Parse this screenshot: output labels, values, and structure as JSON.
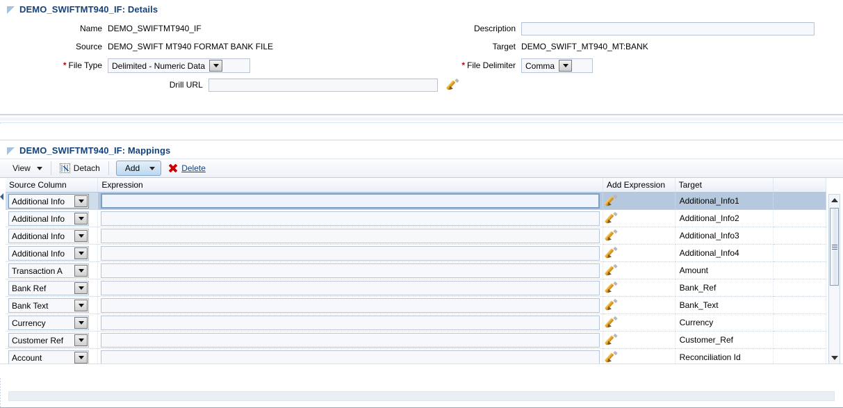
{
  "details_panel": {
    "title": "DEMO_SWIFTMT940_IF: Details",
    "fields": {
      "name_label": "Name",
      "name_value": "DEMO_SWIFTMT940_IF",
      "source_label": "Source",
      "source_value": "DEMO_SWIFT MT940 FORMAT BANK FILE",
      "file_type_label": "File Type",
      "file_type_value": "Delimited - Numeric Data",
      "file_type_required": "*",
      "drill_url_label": "Drill URL",
      "drill_url_value": "",
      "description_label": "Description",
      "description_value": "",
      "target_label": "Target",
      "target_value": "DEMO_SWIFT_MT940_MT:BANK",
      "file_delimiter_label": "File Delimiter",
      "file_delimiter_value": "Comma",
      "file_delimiter_required": "*"
    }
  },
  "mappings_panel": {
    "title": "DEMO_SWIFTMT940_IF: Mappings",
    "toolbar": {
      "view_label": "View",
      "detach_label": "Detach",
      "add_label": "Add",
      "delete_label": "Delete"
    },
    "columns": {
      "source_column": "Source Column",
      "expression": "Expression",
      "add_expression": "Add Expression",
      "target": "Target"
    },
    "rows": [
      {
        "source": "Additional Info",
        "expression": "",
        "target": "Additional_Info1",
        "selected": true
      },
      {
        "source": "Additional Info",
        "expression": "",
        "target": "Additional_Info2",
        "selected": false
      },
      {
        "source": "Additional Info",
        "expression": "",
        "target": "Additional_Info3",
        "selected": false
      },
      {
        "source": "Additional Info",
        "expression": "",
        "target": "Additional_Info4",
        "selected": false
      },
      {
        "source": "Transaction A",
        "expression": "",
        "target": "Amount",
        "selected": false
      },
      {
        "source": "Bank Ref",
        "expression": "",
        "target": "Bank_Ref",
        "selected": false
      },
      {
        "source": "Bank Text",
        "expression": "",
        "target": "Bank_Text",
        "selected": false
      },
      {
        "source": "Currency",
        "expression": "",
        "target": "Currency",
        "selected": false
      },
      {
        "source": "Customer Ref",
        "expression": "",
        "target": "Customer_Ref",
        "selected": false
      },
      {
        "source": "Account",
        "expression": "",
        "target": "Reconciliation Id",
        "selected": false
      }
    ]
  },
  "colors": {
    "header_title": "#14427c",
    "selected_row": "#b6c8de",
    "required_marker": "#cc0000",
    "link": "#14427c"
  }
}
